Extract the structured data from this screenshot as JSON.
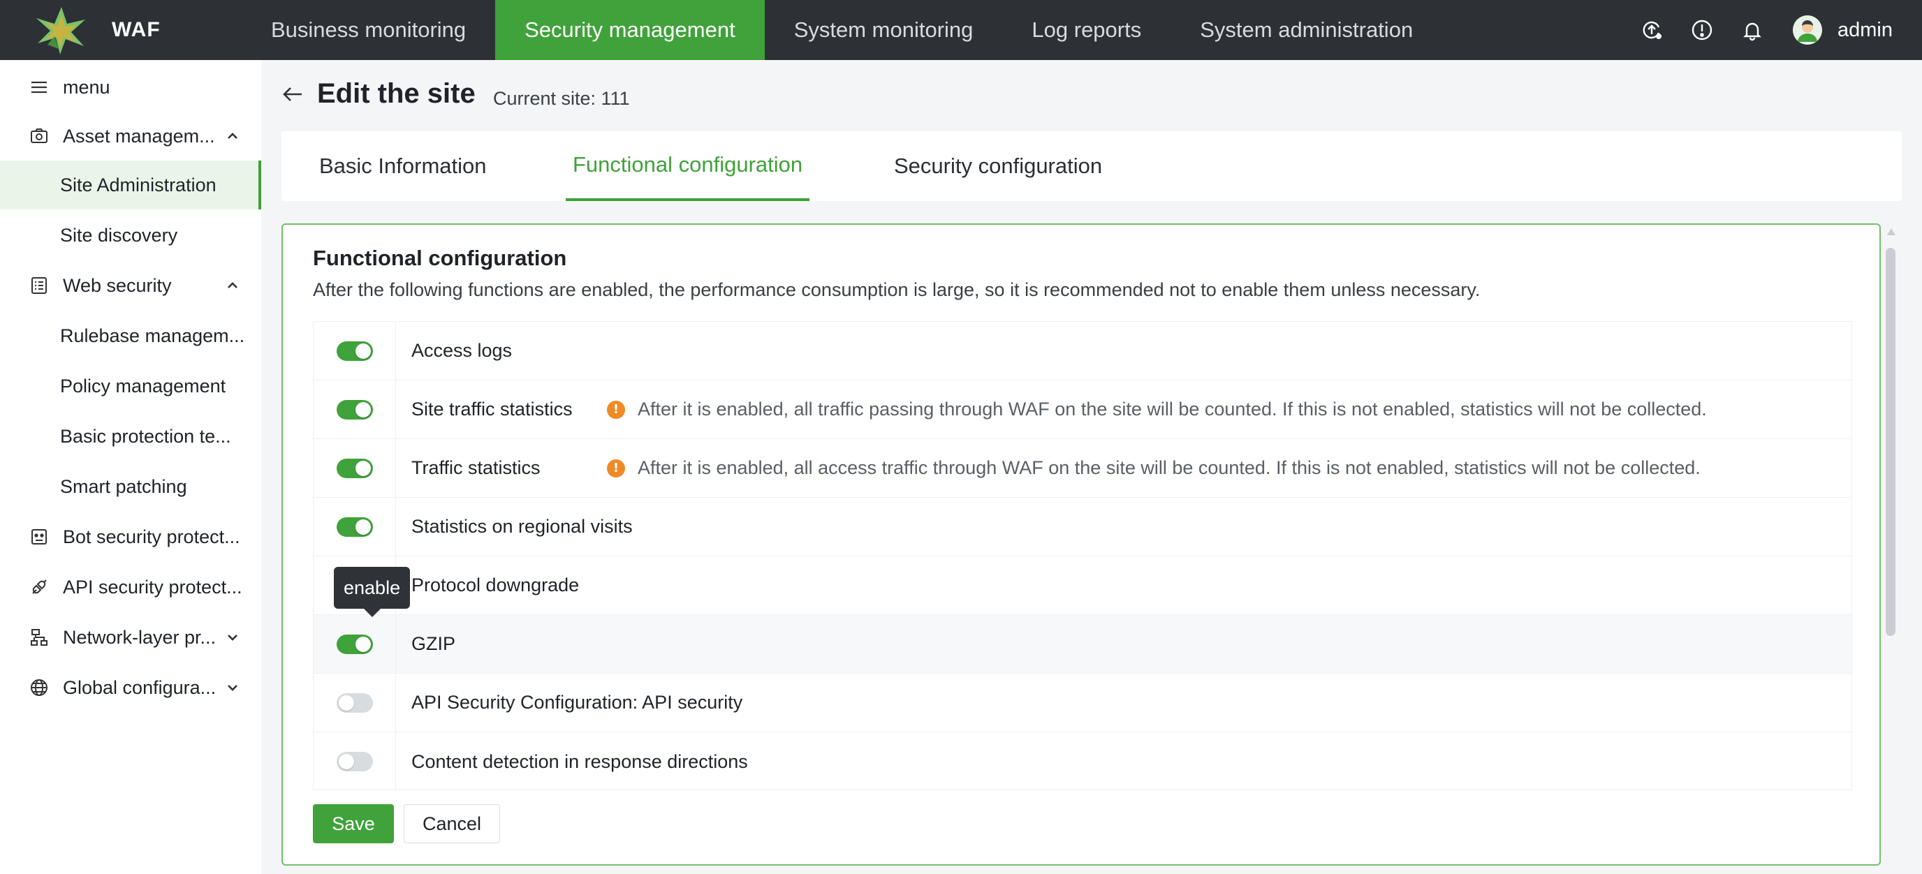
{
  "app": {
    "name": "WAF"
  },
  "nav": {
    "items": [
      {
        "label": "Business monitoring"
      },
      {
        "label": "Security management"
      },
      {
        "label": "System monitoring"
      },
      {
        "label": "Log reports"
      },
      {
        "label": "System administration"
      }
    ],
    "active_index": 1
  },
  "user": {
    "name": "admin"
  },
  "sidebar": {
    "menu_label": "menu",
    "items": [
      {
        "label": "Asset managem...",
        "icon": "asset-icon"
      },
      {
        "label": "Site Administration"
      },
      {
        "label": "Site discovery"
      },
      {
        "label": "Web security",
        "icon": "web-security-icon"
      },
      {
        "label": "Rulebase managem..."
      },
      {
        "label": "Policy management"
      },
      {
        "label": "Basic protection te..."
      },
      {
        "label": "Smart patching"
      },
      {
        "label": "Bot security protect...",
        "icon": "bot-icon"
      },
      {
        "label": "API security protect...",
        "icon": "api-icon"
      },
      {
        "label": "Network-layer pr...",
        "icon": "network-icon"
      },
      {
        "label": "Global configura...",
        "icon": "globe-icon"
      }
    ]
  },
  "header": {
    "title": "Edit the site",
    "current_site": "Current site: 111"
  },
  "tabs": [
    {
      "label": "Basic Information"
    },
    {
      "label": "Functional configuration"
    },
    {
      "label": "Security configuration"
    }
  ],
  "config": {
    "title": "Functional configuration",
    "description": "After the following functions are enabled, the performance consumption is large, so it is recommended not to enable them unless necessary.",
    "rows": [
      {
        "name": "Access logs",
        "enabled": true,
        "info": ""
      },
      {
        "name": "Site traffic statistics",
        "enabled": true,
        "info": "After it is enabled, all traffic passing through WAF on the site will be counted. If this is not enabled, statistics will not be collected."
      },
      {
        "name": "Traffic statistics",
        "enabled": true,
        "info": "After it is enabled, all access traffic through WAF on the site will be counted. If this is not enabled, statistics will not be collected."
      },
      {
        "name": "Statistics on regional visits",
        "enabled": true,
        "info": ""
      },
      {
        "name": "Protocol downgrade",
        "enabled": false,
        "info": ""
      },
      {
        "name": "GZIP",
        "enabled": true,
        "info": ""
      },
      {
        "name": "API Security Configuration: API security",
        "enabled": false,
        "info": ""
      },
      {
        "name": "Content detection in response directions",
        "enabled": false,
        "info": ""
      }
    ],
    "tooltip": "enable",
    "save_label": "Save",
    "cancel_label": "Cancel"
  },
  "colors": {
    "accent": "#3fa23a",
    "topbar": "#2d3136",
    "info": "#ef8a25"
  }
}
